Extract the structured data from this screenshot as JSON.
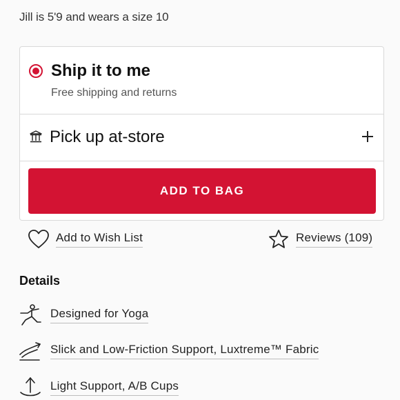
{
  "model_note": "Jill is 5'9 and wears a size 10",
  "shipping": {
    "ship_title": "Ship it to me",
    "ship_subtitle": "Free shipping and returns",
    "pickup_label": "Pick up at-store",
    "selected": "ship"
  },
  "add_to_bag_label": "ADD TO BAG",
  "wish_list_label": "Add to Wish List",
  "reviews_label": "Reviews (109)",
  "details": {
    "title": "Details",
    "features": [
      {
        "label": "Designed for Yoga",
        "icon": "yoga-pose-icon"
      },
      {
        "label": "Slick and Low-Friction Support, Luxtreme™ Fabric",
        "icon": "fabric-swoosh-icon"
      },
      {
        "label": "Light Support, A/B Cups",
        "icon": "light-support-icon"
      }
    ]
  },
  "colors": {
    "accent": "#d31333",
    "border": "#d9d9d9",
    "background": "#fafafa"
  }
}
